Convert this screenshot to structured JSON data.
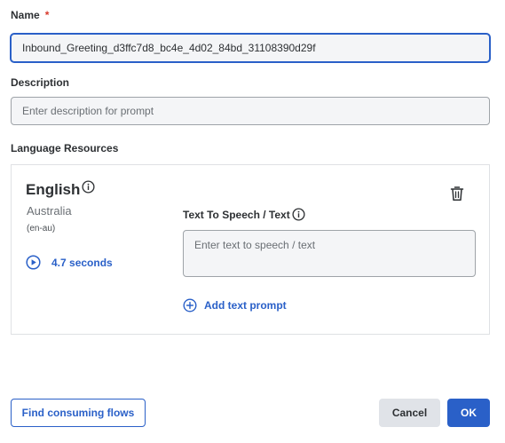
{
  "form": {
    "name_label": "Name",
    "required_marker": "*",
    "name_value": "Inbound_Greeting_d3ffc7d8_bc4e_4d02_84bd_31108390d29f",
    "description_label": "Description",
    "description_placeholder": "Enter description for prompt",
    "language_resources_label": "Language Resources"
  },
  "resource": {
    "language": "English",
    "region": "Australia",
    "code": "(en-au)",
    "duration": "4.7 seconds",
    "tts_label": "Text To Speech / Text",
    "tts_placeholder": "Enter text to speech / text",
    "add_text_prompt": "Add text prompt"
  },
  "footer": {
    "find_consuming_flows": "Find consuming flows",
    "cancel": "Cancel",
    "ok": "OK"
  },
  "colors": {
    "accent": "#2a60c8",
    "required": "#d83a2c",
    "text": "#2d3033",
    "muted": "#6a6f74",
    "input_bg": "#f4f5f7"
  },
  "icons": [
    "info-icon",
    "play-icon",
    "trash-icon",
    "plus-circle-icon"
  ]
}
